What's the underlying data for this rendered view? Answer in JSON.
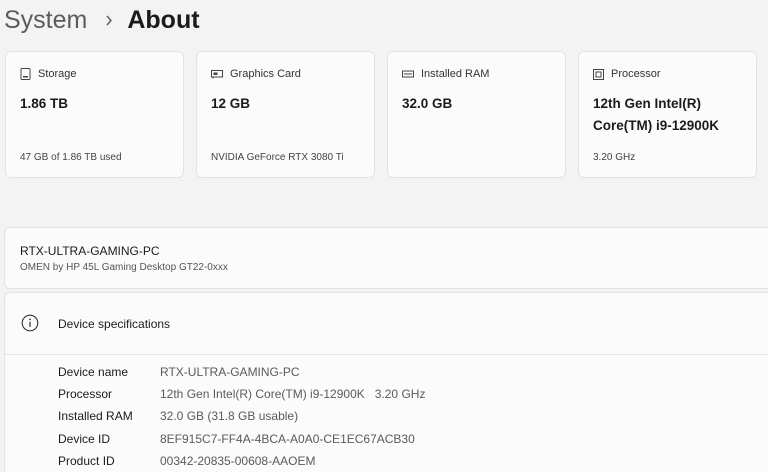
{
  "breadcrumb": {
    "parent": "System",
    "current": "About"
  },
  "cards": [
    {
      "icon": "storage-icon",
      "label": "Storage",
      "value": "1.86 TB",
      "sub": "47 GB of 1.86 TB used"
    },
    {
      "icon": "graphics-card-icon",
      "label": "Graphics Card",
      "value": "12 GB",
      "sub": "NVIDIA GeForce RTX 3080 Ti"
    },
    {
      "icon": "ram-icon",
      "label": "Installed RAM",
      "value": "32.0 GB",
      "sub": ""
    },
    {
      "icon": "processor-icon",
      "label": "Processor",
      "value": "12th Gen Intel(R) Core(TM) i9-12900K",
      "sub": "3.20 GHz"
    }
  ],
  "device": {
    "name": "RTX-ULTRA-GAMING-PC",
    "model": "OMEN by HP 45L Gaming Desktop GT22-0xxx"
  },
  "specs": {
    "title": "Device specifications",
    "rows": [
      {
        "label": "Device name",
        "value": "RTX-ULTRA-GAMING-PC"
      },
      {
        "label": "Processor",
        "value": "12th Gen Intel(R) Core(TM) i9-12900K   3.20 GHz"
      },
      {
        "label": "Installed RAM",
        "value": "32.0 GB (31.8 GB usable)"
      },
      {
        "label": "Device ID",
        "value": "8EF915C7-FF4A-4BCA-A0A0-CE1EC67ACB30"
      },
      {
        "label": "Product ID",
        "value": "00342-20835-00608-AAOEM"
      }
    ]
  }
}
